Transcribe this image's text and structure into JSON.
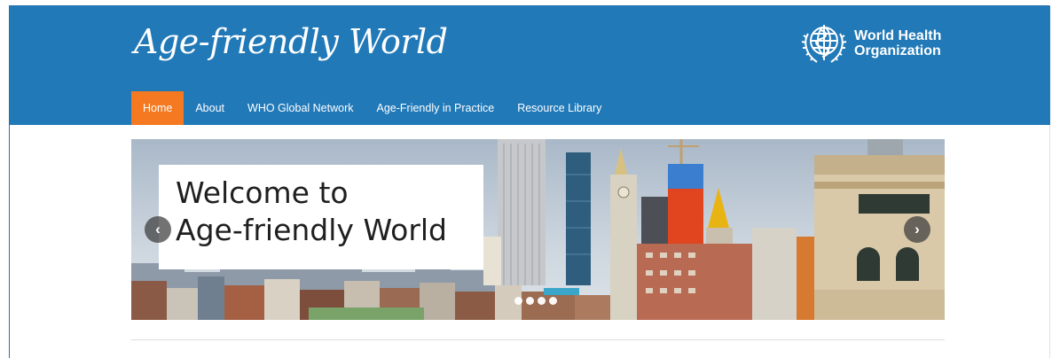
{
  "header": {
    "logo_text": "Age-friendly World",
    "who": {
      "line1": "World Health",
      "line2": "Organization"
    },
    "bg_color": "#2179b8"
  },
  "nav": {
    "active_color": "#f47920",
    "items": [
      {
        "label": "Home",
        "active": true
      },
      {
        "label": "About",
        "active": false
      },
      {
        "label": "WHO Global Network",
        "active": false
      },
      {
        "label": "Age-Friendly in Practice",
        "active": false
      },
      {
        "label": "Resource Library",
        "active": false
      }
    ]
  },
  "hero": {
    "title_line1": "Welcome to",
    "title_line2": "Age-friendly World",
    "prev_icon": "chevron-left-icon",
    "next_icon": "chevron-right-icon",
    "prev_glyph": "‹",
    "next_glyph": "›",
    "slide_count": 4,
    "active_slide": 1
  }
}
